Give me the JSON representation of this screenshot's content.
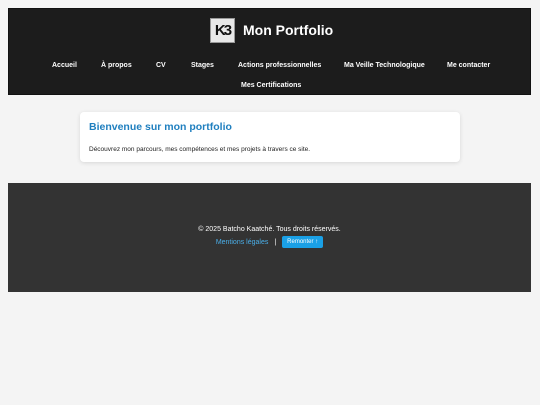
{
  "header": {
    "logo_text": "K3",
    "title": "Mon Portfolio",
    "nav": [
      {
        "label": "Accueil"
      },
      {
        "label": "À propos"
      },
      {
        "label": "CV"
      },
      {
        "label": "Stages"
      },
      {
        "label": "Actions professionnelles"
      },
      {
        "label": "Ma Veille Technologique"
      },
      {
        "label": "Me contacter"
      },
      {
        "label": "Mes Certifications"
      }
    ]
  },
  "main": {
    "heading": "Bienvenue sur mon portfolio",
    "intro": "Découvrez mon parcours, mes compétences et mes projets à travers ce site."
  },
  "footer": {
    "copyright": "© 2025 Batcho Kaatché. Tous droits réservés.",
    "legal_link": "Mentions légales",
    "separator": "|",
    "back_to_top": "Remonter ↑"
  },
  "colors": {
    "header_bg": "#1c1c1c",
    "page_bg": "#f4f4f4",
    "footer_bg": "#333333",
    "heading_blue": "#1f7fbf",
    "link_blue": "#4aaee8",
    "button_blue": "#1aa0e6"
  }
}
